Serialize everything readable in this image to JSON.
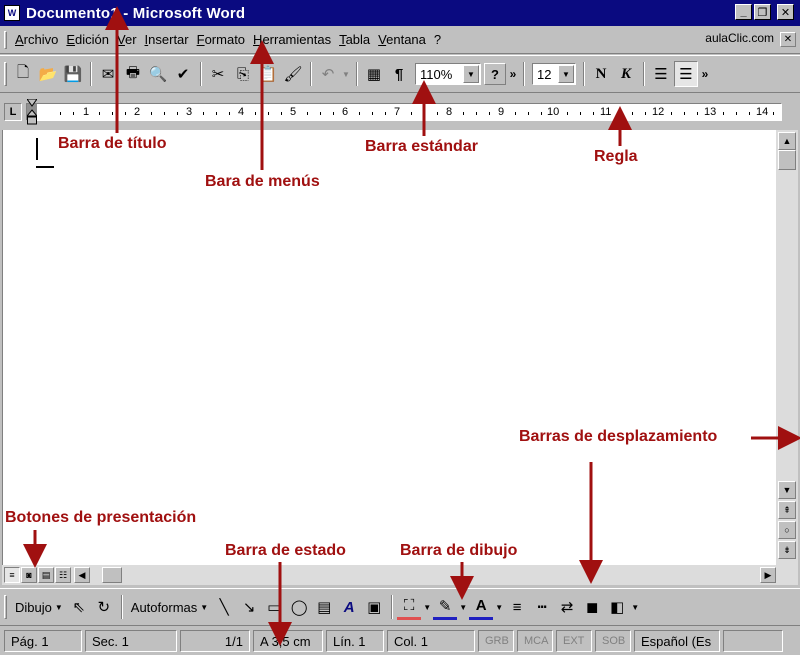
{
  "window": {
    "title": "Documento1 - Microsoft Word",
    "icon": "word-document-icon",
    "controls": {
      "minimize": "_",
      "maximize": "❐",
      "close": "✕"
    }
  },
  "menubar": {
    "items": [
      "Archivo",
      "Edición",
      "Ver",
      "Insertar",
      "Formato",
      "Herramientas",
      "Tabla",
      "Ventana",
      "?"
    ],
    "brand": "aulaClic.com",
    "close_doc": "✕"
  },
  "toolbar": {
    "zoom": "110%",
    "font_size": "12",
    "bold": "N",
    "italic": "K"
  },
  "ruler": {
    "tab_selector": "L",
    "numbers": [
      "1",
      "2",
      "3",
      "4",
      "5",
      "6",
      "7",
      "8",
      "9",
      "10",
      "11",
      "12",
      "13",
      "14"
    ]
  },
  "drawbar": {
    "draw_menu": "Dibujo",
    "autoshapes_menu": "Autoformas"
  },
  "statusbar": {
    "page": "Pág.  1",
    "section": "Sec.  1",
    "pages": "1/1",
    "position": "A  3,5 cm",
    "line": "Lín.  1",
    "column": "Col.  1",
    "modes": [
      "GRB",
      "MCA",
      "EXT",
      "SOB"
    ],
    "language": "Español (Es"
  },
  "annotations": {
    "title_bar": "Barra de título",
    "menu_bar": "Bara de menús",
    "standard_bar": "Barra estándar",
    "ruler": "Regla",
    "scroll_bars": "Barras de desplazamiento",
    "view_buttons": "Botones de presentación",
    "status_bar": "Barra de estado",
    "drawing_bar": "Barra de dibujo"
  },
  "colors": {
    "title_bar": "#0a0a80",
    "annotation": "#a01010",
    "chrome": "#c0c0c0"
  }
}
